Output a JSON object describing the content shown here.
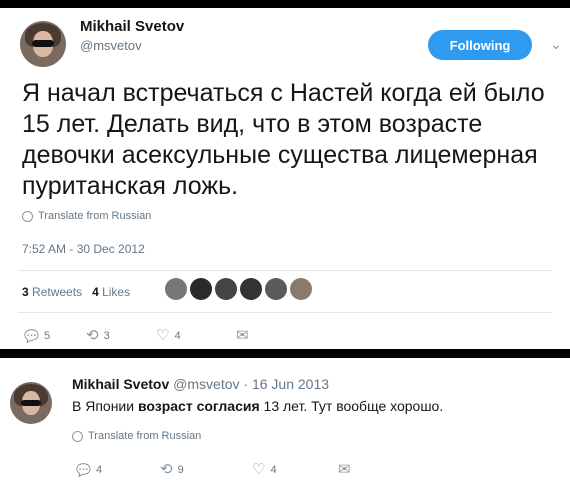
{
  "tweet1": {
    "author_name": "Mikhail Svetov",
    "handle": "@msvetov",
    "follow_label": "Following",
    "text": "Я начал встречаться с Настей когда ей было 15 лет. Делать вид, что в этом возрасте девочки асексульные существа лицемерная пуританская ложь.",
    "translate_label": "Translate from Russian",
    "timestamp": "7:52 AM - 30 Dec 2012",
    "retweets_count": "3",
    "retweets_label": "Retweets",
    "likes_count": "4",
    "likes_label": "Likes",
    "actions": {
      "reply_count": "5",
      "retweet_count": "3",
      "like_count": "4"
    }
  },
  "tweet2": {
    "author_name": "Mikhail Svetov",
    "handle": "@msvetov",
    "separator": "·",
    "date": "16 Jun 2013",
    "text_pre": "В Японии",
    "text_bold": "возраст согласия",
    "text_post": "13 лет. Тут вообще хорошо.",
    "translate_label": "Translate from Russian",
    "actions": {
      "reply_count": "4",
      "retweet_count": "9",
      "like_count": "4"
    }
  },
  "icons": {
    "reply": "💬",
    "retweet": "⟲",
    "like": "♡",
    "dm": "✉",
    "chevron": "⌄"
  }
}
